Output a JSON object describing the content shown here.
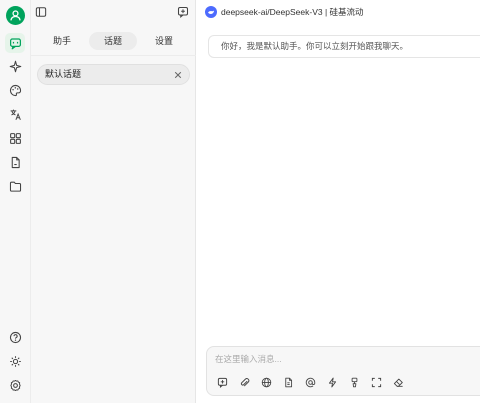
{
  "sidebar": {
    "icons": [
      "user-icon",
      "chat-icon",
      "sparkle-icon",
      "palette-icon",
      "translate-icon",
      "apps-icon",
      "files-icon",
      "folder-icon",
      "help-icon",
      "theme-icon",
      "settings-icon"
    ]
  },
  "panel": {
    "tabs": [
      {
        "label": "助手",
        "active": false
      },
      {
        "label": "话题",
        "active": true
      },
      {
        "label": "设置",
        "active": false
      }
    ],
    "topics": [
      {
        "label": "默认话题"
      }
    ]
  },
  "main": {
    "model_name": "deepseek-ai/DeepSeek-V3 | 硅基流动",
    "assistant_message": "你好，我是默认助手。你可以立刻开始跟我聊天。",
    "input": {
      "placeholder": "在这里输入消息..."
    },
    "toolbar_icons": [
      "new-topic-icon",
      "attachment-icon",
      "web-search-icon",
      "knowledge-base-icon",
      "mention-icon",
      "quick-phrase-icon",
      "clear-context-icon",
      "fullscreen-icon",
      "clear-icon"
    ]
  },
  "colors": {
    "accent": "#00a35c",
    "model_badge": "#4d6bfe",
    "panel_bg": "#f7f7f7"
  }
}
